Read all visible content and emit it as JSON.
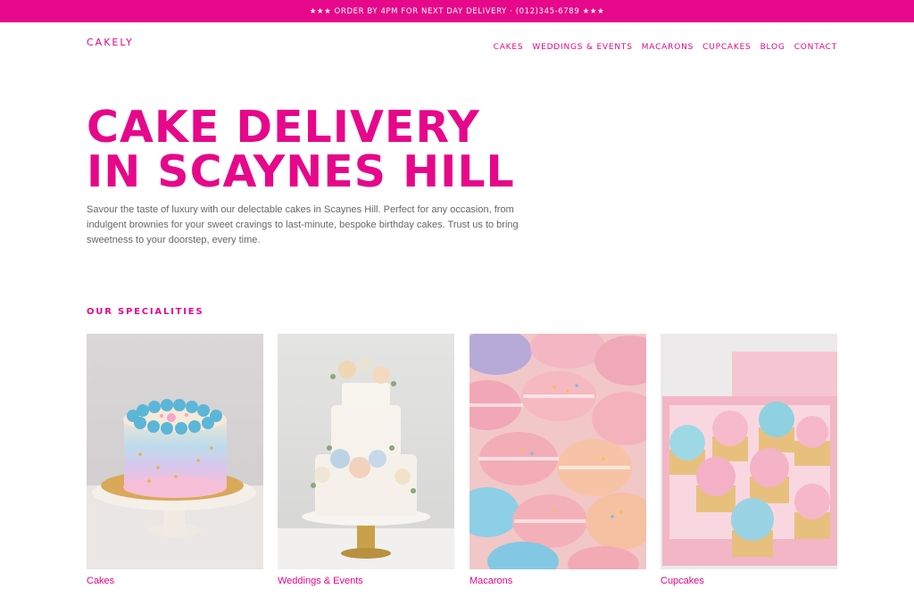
{
  "promo_bar": {
    "text": "★★★ ORDER BY 4PM FOR NEXT DAY DELIVERY · (012)345-6789 ★★★"
  },
  "header": {
    "logo": "CAKELY",
    "nav": [
      {
        "label": "CAKES"
      },
      {
        "label": "WEDDINGS & EVENTS"
      },
      {
        "label": "MACARONS"
      },
      {
        "label": "CUPCAKES"
      },
      {
        "label": "BLOG"
      },
      {
        "label": "CONTACT"
      }
    ]
  },
  "hero": {
    "title_line1": "CAKE DELIVERY",
    "title_line2": "IN SCAYNES HILL",
    "description": "Savour the taste of luxury with our delectable cakes in Scaynes Hill. Perfect for any occasion, from indulgent brownies for your sweet cravings to last-minute, bespoke birthday cakes. Trust us to bring sweetness to your doorstep, every time."
  },
  "specialities": {
    "heading": "OUR SPECIALITIES",
    "items": [
      {
        "label": "Cakes"
      },
      {
        "label": "Weddings & Events"
      },
      {
        "label": "Macarons"
      },
      {
        "label": "Cupcakes"
      }
    ]
  },
  "colors": {
    "brand": "#e6078a",
    "body_text": "#666666",
    "background": "#ffffff"
  }
}
